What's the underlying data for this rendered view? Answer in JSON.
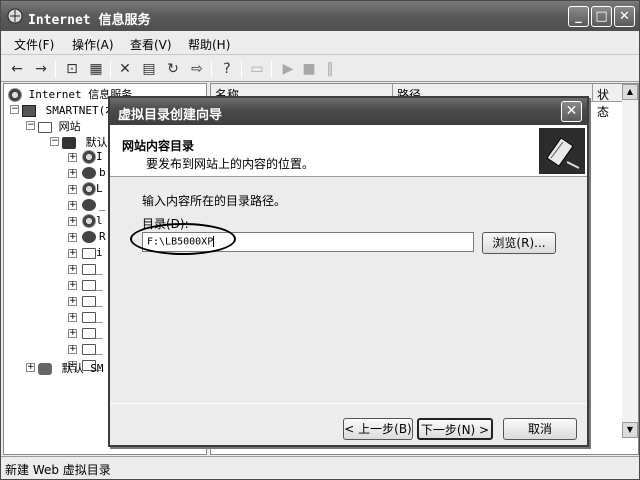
{
  "window": {
    "title": "Internet 信息服务",
    "buttons": [
      "_",
      "□",
      "✕"
    ]
  },
  "menu": [
    "文件(F)",
    "操作(A)",
    "查看(V)",
    "帮助(H)"
  ],
  "toolbar": {
    "icons": [
      "back-arrow-icon",
      "forward-arrow-icon",
      "up-folder-icon",
      "show-tree-icon",
      "delete-icon",
      "properties-icon",
      "refresh-icon",
      "export-icon",
      "help-icon",
      "computer-icon",
      "play-icon",
      "stop-icon",
      "pause-icon"
    ]
  },
  "tree": {
    "root": "Internet 信息服务",
    "server": "SMARTNET(本",
    "websites": "网站",
    "default_site": "默认",
    "children": [
      "I",
      "b",
      "L",
      "_",
      "l",
      "R",
      "i",
      "_",
      "_",
      "_",
      "_",
      "_",
      "_",
      "_",
      "_"
    ],
    "smtp": "默认 SM"
  },
  "list": {
    "columns": [
      "名称",
      "路径",
      "状态"
    ]
  },
  "status": {
    "text": "新建 Web 虚拟目录"
  },
  "wizard": {
    "title": "虚拟目录创建向导",
    "heading": "网站内容目录",
    "subheading": "要发布到网站上的内容的位置。",
    "instruction": "输入内容所在的目录路径。",
    "dir_label": "目录(D):",
    "dir_value": "F:\\LB5000XP",
    "browse": "浏览(R)...",
    "back": "< 上一步(B)",
    "next": "下一步(N) >",
    "cancel": "取消"
  }
}
